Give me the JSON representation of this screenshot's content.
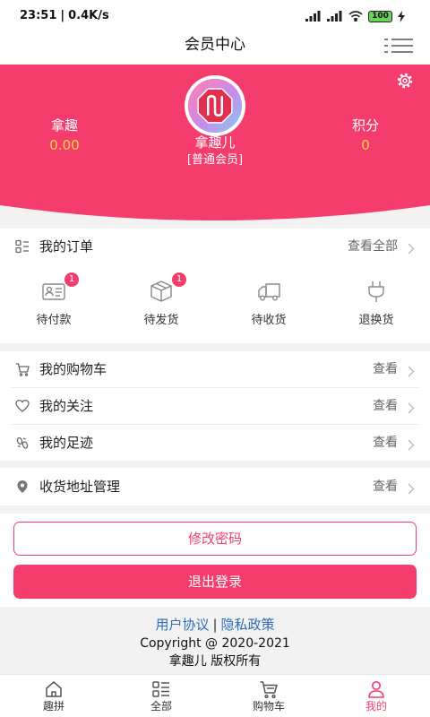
{
  "status_bar": {
    "time": "23:51",
    "separator": "|",
    "net_speed": "0.4K/s",
    "battery": "100"
  },
  "header": {
    "title": "会员中心",
    "menu_icon": "menu-icon"
  },
  "profile": {
    "balance": {
      "label": "拿趣",
      "value": "0.00"
    },
    "name": "拿趣儿",
    "level": "[普通会员]",
    "points": {
      "label": "积分",
      "value": "0"
    },
    "settings_icon": "gear-icon"
  },
  "orders": {
    "title": "我的订单",
    "view_all": "查看全部",
    "items": [
      {
        "label": "待付款",
        "icon": "payment-card-icon",
        "badge": "1"
      },
      {
        "label": "待发货",
        "icon": "box-icon",
        "badge": "1"
      },
      {
        "label": "待收货",
        "icon": "truck-icon"
      },
      {
        "label": "退换货",
        "icon": "plug-icon"
      }
    ]
  },
  "menu": [
    {
      "label": "我的购物车",
      "action": "查看",
      "icon": "cart-icon"
    },
    {
      "label": "我的关注",
      "action": "查看",
      "icon": "heart-icon"
    },
    {
      "label": "我的足迹",
      "action": "查看",
      "icon": "footprint-icon"
    }
  ],
  "address": {
    "label": "收货地址管理",
    "action": "查看",
    "icon": "location-icon"
  },
  "buttons": {
    "change_password": "修改密码",
    "logout": "退出登录"
  },
  "footer": {
    "user_agreement": "用户协议",
    "divider": "|",
    "privacy_policy": "隐私政策",
    "copyright": "Copyright @ 2020-2021",
    "rights": "拿趣儿 版权所有"
  },
  "tabbar": [
    {
      "label": "趣拼",
      "icon": "home-icon",
      "active": false
    },
    {
      "label": "全部",
      "icon": "category-list-icon",
      "active": false
    },
    {
      "label": "购物车",
      "icon": "cart-icon",
      "active": false
    },
    {
      "label": "我的",
      "icon": "person-icon",
      "active": true
    }
  ],
  "colors": {
    "accent": "#F43D6D",
    "points": "#FFD43B",
    "link": "#2F6EB5"
  }
}
